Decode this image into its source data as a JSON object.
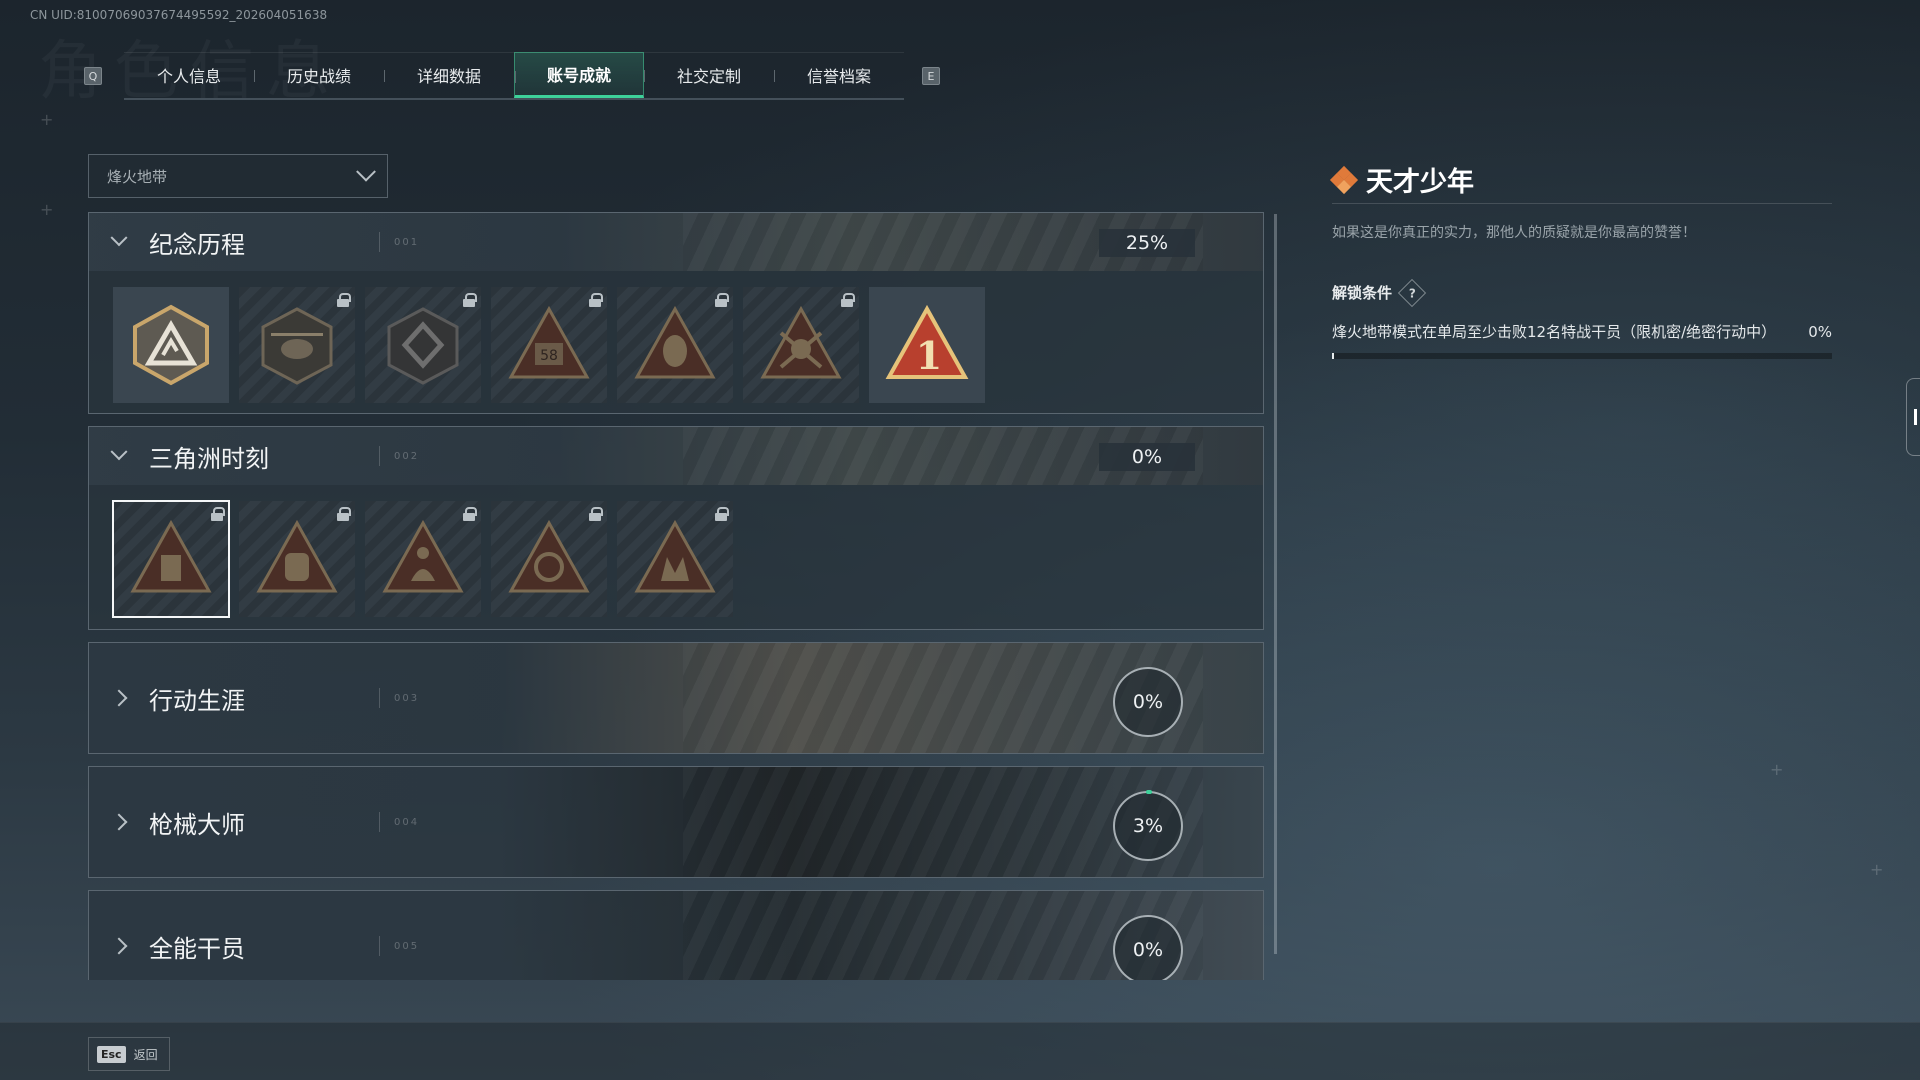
{
  "uid_text": "CN UID:81007069037674495592_202604051638",
  "tabs": {
    "left_key": "Q",
    "right_key": "E",
    "items": [
      {
        "label": "个人信息"
      },
      {
        "label": "历史战绩"
      },
      {
        "label": "详细数据"
      },
      {
        "label": "账号成就",
        "active": true
      },
      {
        "label": "社交定制"
      },
      {
        "label": "信誉档案"
      }
    ]
  },
  "filter": {
    "selected": "烽火地带"
  },
  "categories": [
    {
      "title": "纪念历程",
      "code": "001",
      "percent": "25%",
      "expanded": true
    },
    {
      "title": "三角洲时刻",
      "code": "002",
      "percent": "0%",
      "expanded": true
    },
    {
      "title": "行动生涯",
      "code": "003",
      "percent": "0%",
      "expanded": false
    },
    {
      "title": "枪械大师",
      "code": "004",
      "percent": "3%",
      "expanded": false
    },
    {
      "title": "全能干员",
      "code": "005",
      "percent": "0%",
      "expanded": false
    }
  ],
  "badges_group1": [
    {
      "name": "badge-shield-emblem",
      "locked": false
    },
    {
      "name": "badge-helicopter",
      "locked": true
    },
    {
      "name": "badge-diamond-shield",
      "locked": true
    },
    {
      "name": "badge-58",
      "locked": true
    },
    {
      "name": "badge-mask",
      "locked": true
    },
    {
      "name": "badge-skull-swords",
      "locked": true
    },
    {
      "name": "badge-number-one",
      "locked": false
    }
  ],
  "badges_group2": [
    {
      "name": "badge-device",
      "locked": true,
      "selected": true
    },
    {
      "name": "badge-mask-tri",
      "locked": true
    },
    {
      "name": "badge-figure",
      "locked": true
    },
    {
      "name": "badge-globe",
      "locked": true
    },
    {
      "name": "badge-soldiers",
      "locked": true
    }
  ],
  "detail": {
    "title": "天才少年",
    "description": "如果这是你真正的实力，那他人的质疑就是你最高的赞誉！",
    "condition_label": "解锁条件",
    "help_glyph": "?",
    "condition_text": "烽火地带模式在单局至少击败12名特战干员（限机密/绝密行动中）",
    "condition_percent": "0%",
    "condition_progress": 0.0
  },
  "footer": {
    "esc_key": "Esc",
    "esc_label": "返回"
  },
  "colors": {
    "accent": "#3ed19a",
    "title_icon": "#e07a3a"
  }
}
